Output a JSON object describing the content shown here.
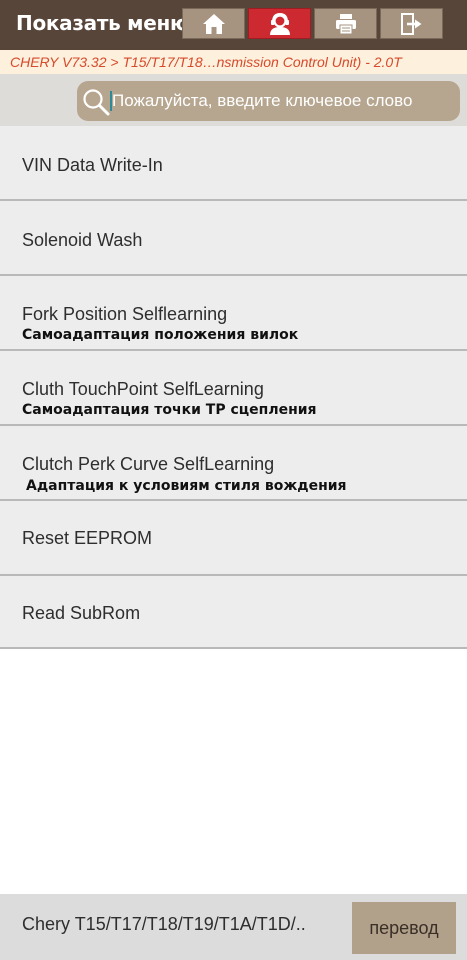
{
  "header": {
    "menu_title": "Показать меню",
    "buttons": [
      {
        "icon": "home-icon"
      },
      {
        "icon": "support-agent-icon",
        "active": true
      },
      {
        "icon": "printer-icon"
      },
      {
        "icon": "exit-icon"
      }
    ],
    "colors": {
      "bar": "#58453a",
      "button": "#a69481",
      "active": "#cc2a30"
    }
  },
  "breadcrumb": "CHERY V73.32 > T15/T17/T18…nsmission Control Unit) - 2.0T",
  "search": {
    "placeholder": "Пожалуйста, введите ключевое слово",
    "icon": "search-icon"
  },
  "menu_items": [
    {
      "label": "VIN Data Write-In",
      "sub": ""
    },
    {
      "label": "Solenoid Wash",
      "sub": ""
    },
    {
      "label": "Fork Position Selflearning",
      "sub": "Самоадаптация положения вилок"
    },
    {
      "label": "Cluth TouchPoint SelfLearning",
      "sub": "Самоадаптация точки ТР сцепления"
    },
    {
      "label": "Clutch Perk Curve SelfLearning",
      "sub": "Адаптация к условиям стиля вождения"
    },
    {
      "label": "Reset EEPROM",
      "sub": ""
    },
    {
      "label": "Read SubRom",
      "sub": ""
    }
  ],
  "footer": {
    "vehicle": "Chery T15/T17/T18/T19/T1A/T1D/..",
    "translate_label": "перевод"
  }
}
